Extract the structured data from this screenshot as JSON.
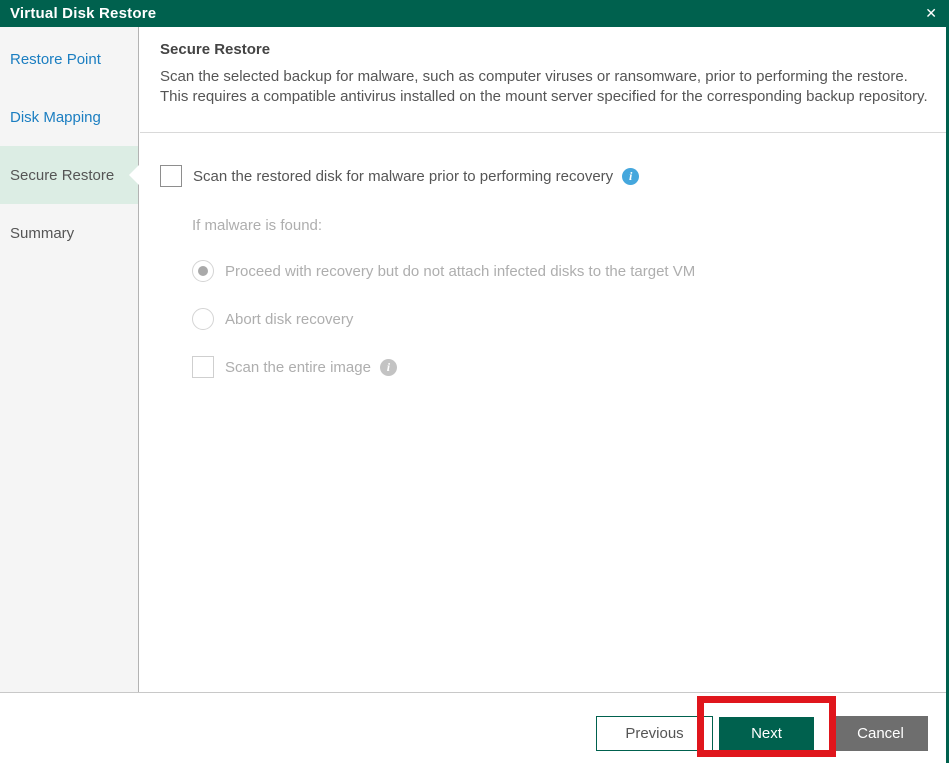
{
  "window": {
    "title": "Virtual Disk Restore"
  },
  "icons": {
    "close": "✕",
    "info": "i"
  },
  "colors": {
    "accent_green": "#00614E",
    "link_blue": "#1B7EC1",
    "active_step_bg": "#DCEDE4",
    "sidebar_bg": "#F5F5F5",
    "info_blue": "#45A7DD",
    "cancel_gray": "#6E6E6E",
    "annotation_red": "#E0161C"
  },
  "sidebar": {
    "items": [
      {
        "label": "Restore Point",
        "state": "link"
      },
      {
        "label": "Disk Mapping",
        "state": "link"
      },
      {
        "label": "Secure Restore",
        "state": "active"
      },
      {
        "label": "Summary",
        "state": "plain"
      }
    ]
  },
  "content": {
    "heading": "Secure Restore",
    "description": "Scan the selected backup for malware, such as computer viruses or ransomware, prior to performing the restore. This requires a compatible antivirus installed on the mount server specified for the corresponding backup repository.",
    "scan_checkbox": {
      "label": "Scan the restored disk for malware prior to performing recovery",
      "checked": false
    },
    "disabled_group": {
      "if_malware_label": "If malware is found:",
      "radio_proceed": {
        "label": "Proceed with recovery but do not attach infected disks to the target VM",
        "selected": true
      },
      "radio_abort": {
        "label": "Abort disk recovery",
        "selected": false
      },
      "entire_image_checkbox": {
        "label": "Scan the entire image",
        "checked": false
      }
    }
  },
  "footer": {
    "previous_label": "Previous",
    "next_label": "Next",
    "cancel_label": "Cancel"
  }
}
